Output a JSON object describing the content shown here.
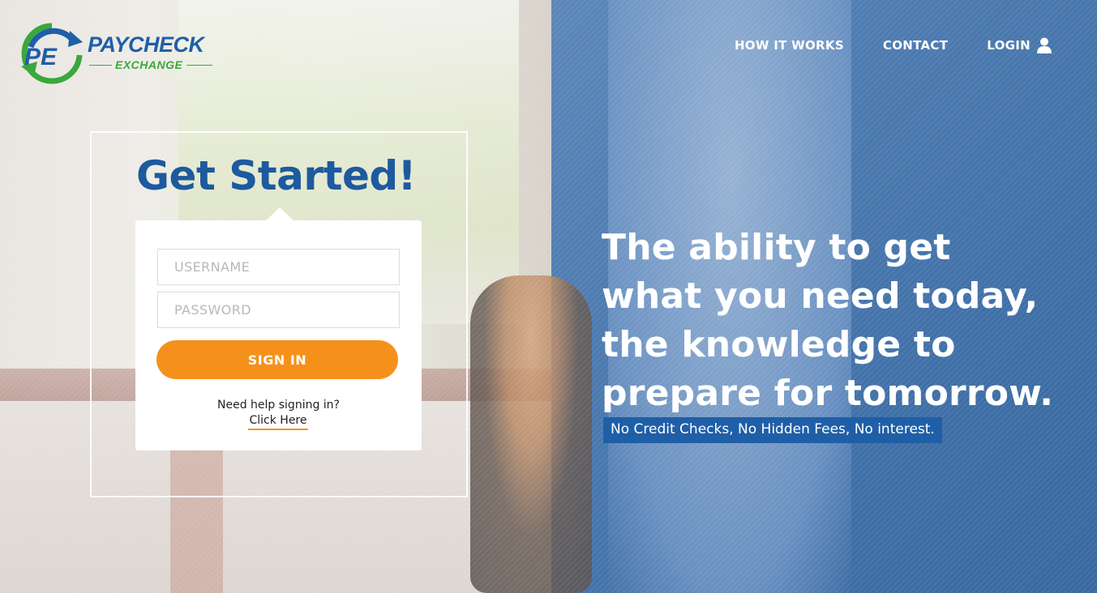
{
  "brand": {
    "logo_mark": "PE",
    "name_line1": "PAYCHECK",
    "name_line2": "EXCHANGE",
    "primary_color": "#1f5fa8",
    "accent_color": "#3aa83c"
  },
  "nav": {
    "items": [
      {
        "label": "HOW IT WORKS"
      },
      {
        "label": "CONTACT"
      },
      {
        "label": "LOGIN",
        "icon": "user-icon"
      }
    ]
  },
  "login": {
    "title": "Get Started!",
    "username_placeholder": "USERNAME",
    "password_placeholder": "PASSWORD",
    "submit_label": "SIGN IN",
    "submit_color": "#f5911b",
    "help_text": "Need help signing in?",
    "help_link": "Click Here"
  },
  "hero": {
    "lines": [
      "The ability to get",
      "what you need today,",
      "the knowledge to",
      "prepare for tomorrow."
    ],
    "tagline": "No Credit Checks, No Hidden Fees, No interest."
  }
}
